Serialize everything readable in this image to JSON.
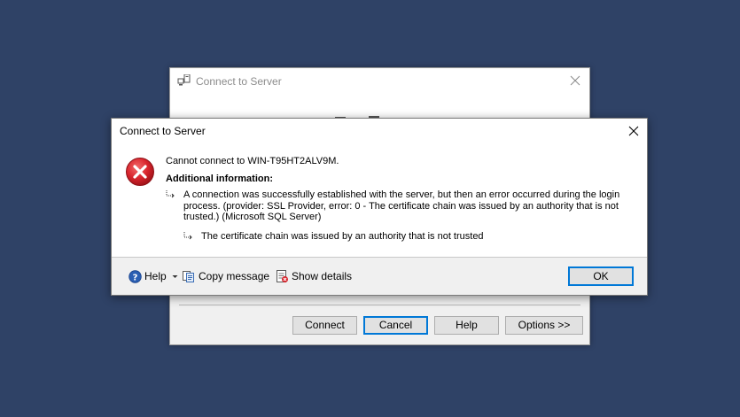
{
  "background_window": {
    "title": "Connect to Server",
    "buttons": {
      "connect": "Connect",
      "cancel": "Cancel",
      "help": "Help",
      "options": "Options >>"
    }
  },
  "error_dialog": {
    "title": "Connect to Server",
    "main_message": "Cannot connect to WIN-T95HT2ALV9M.",
    "additional_heading": "Additional information:",
    "detail_message": "A connection was successfully established with the server, but then an error occurred during the login process. (provider: SSL Provider, error: 0 - The certificate chain was issued by an authority that is not trusted.) (Microsoft SQL Server)",
    "inner_message": "The certificate chain was issued by an authority that is not trusted",
    "footer": {
      "help_label": "Help",
      "copy_label": "Copy message",
      "details_label": "Show details",
      "ok_label": "OK"
    }
  },
  "colors": {
    "desktop": "#2f4266",
    "error_red": "#d8242c",
    "accent_blue": "#0078d7"
  }
}
